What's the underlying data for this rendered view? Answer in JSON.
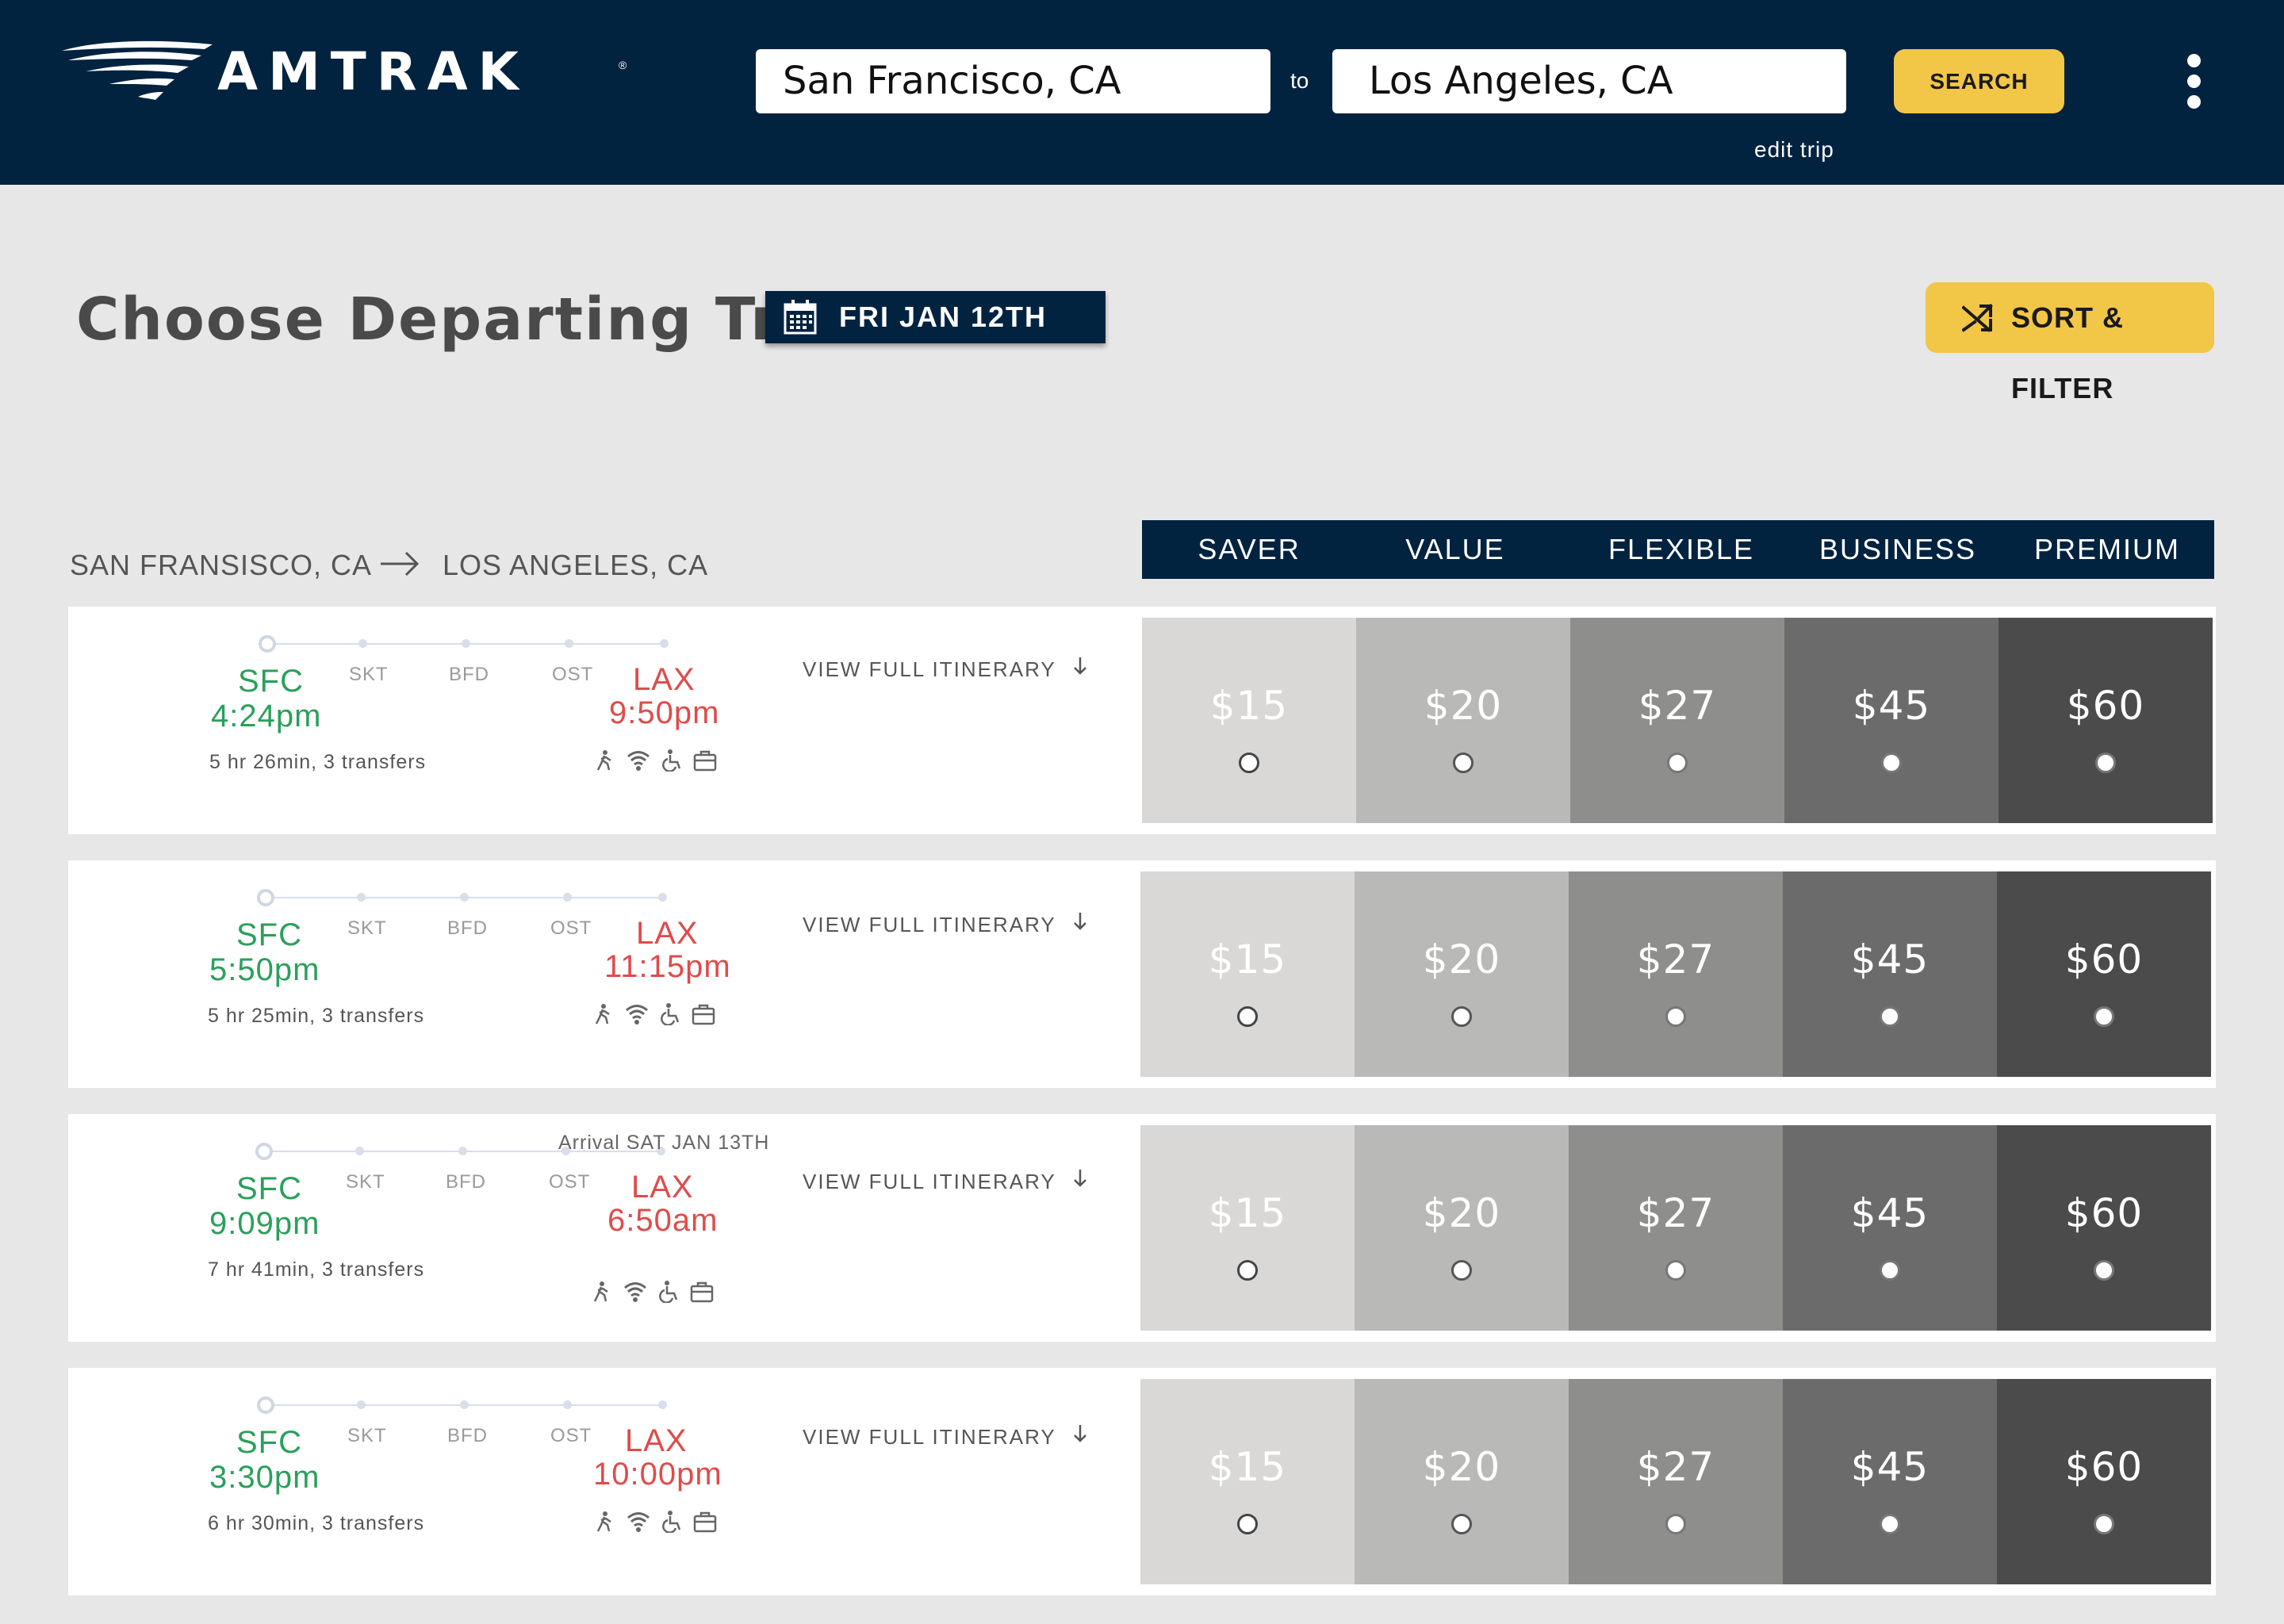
{
  "header": {
    "brand": "AMTRAK",
    "brand_mark": "®",
    "from_value": "San Francisco, CA",
    "to_label": "to",
    "to_value": "Los Angeles, CA",
    "search_label": "SEARCH",
    "edit_trip_label": "edit trip"
  },
  "page": {
    "title": "Choose Departing Train",
    "date": "FRI JAN 12TH",
    "sort_filter_label": "SORT & FILTER"
  },
  "route": {
    "origin": "SAN FRANSISCO, CA",
    "destination": "LOS ANGELES, CA"
  },
  "fare_classes": [
    "SAVER",
    "VALUE",
    "FLEXIBLE",
    "BUSINESS",
    "PREMIUM"
  ],
  "view_itinerary_label": "VIEW FULL ITINERARY",
  "stops": [
    "SKT",
    "BFD",
    "OST"
  ],
  "trains": [
    {
      "from_code": "SFC",
      "depart": "4:24pm",
      "to_code": "LAX",
      "arrive": "9:50pm",
      "duration": "5 hr  26min,  3 transfers",
      "arrival_note": "",
      "prices": [
        "$15",
        "$20",
        "$27",
        "$45",
        "$60"
      ]
    },
    {
      "from_code": "SFC",
      "depart": "5:50pm",
      "to_code": "LAX",
      "arrive": "11:15pm",
      "duration": "5 hr  25min,  3 transfers",
      "arrival_note": "",
      "prices": [
        "$15",
        "$20",
        "$27",
        "$45",
        "$60"
      ]
    },
    {
      "from_code": "SFC",
      "depart": "9:09pm",
      "to_code": "LAX",
      "arrive": "6:50am",
      "duration": "7 hr  41min,  3 transfers",
      "arrival_note": "Arrival SAT JAN 13TH",
      "prices": [
        "$15",
        "$20",
        "$27",
        "$45",
        "$60"
      ]
    },
    {
      "from_code": "SFC",
      "depart": "3:30pm",
      "to_code": "LAX",
      "arrive": "10:00pm",
      "duration": "6 hr 30min,  3 transfers",
      "arrival_note": "",
      "prices": [
        "$15",
        "$20",
        "$27",
        "$45",
        "$60"
      ]
    }
  ],
  "amenity_icons": [
    "accessible-walk-icon",
    "wifi-icon",
    "wheelchair-icon",
    "luggage-icon"
  ],
  "colors": {
    "navy": "#012340",
    "accent_yellow": "#f2c647",
    "depart_green": "#2aa05a",
    "arrive_red": "#e04b4b"
  }
}
